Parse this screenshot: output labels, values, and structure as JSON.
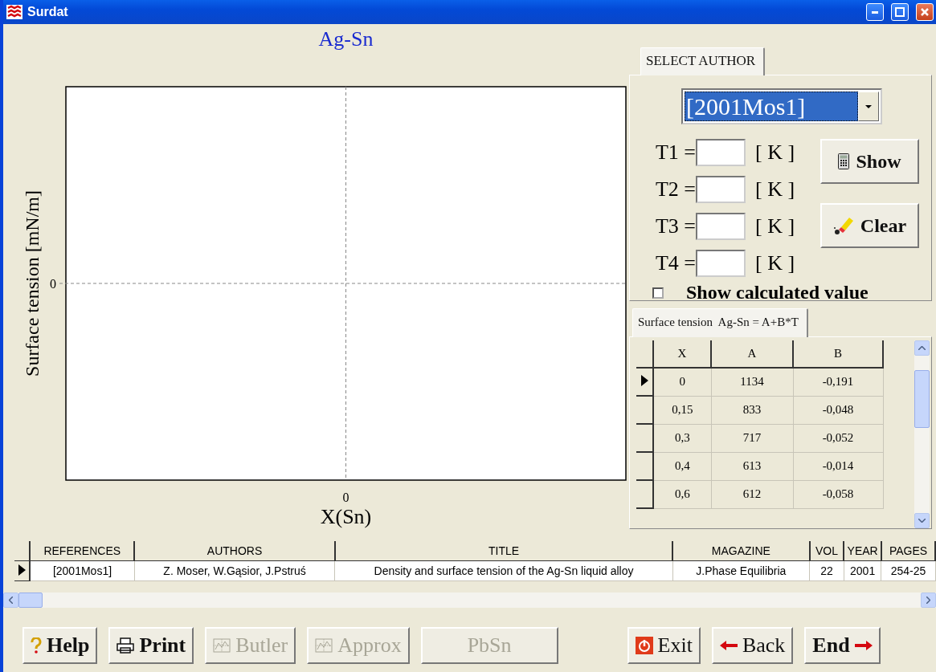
{
  "window": {
    "title": "Surdat"
  },
  "plot": {
    "title": "Ag-Sn",
    "x_axis_label": "X(Sn)",
    "y_axis_label": "Surface tension [mN/m]",
    "x_tick_labels": [
      "0"
    ],
    "y_tick_labels": [
      "0"
    ]
  },
  "author_panel": {
    "tab": {
      "label": "SELECT AUTHOR",
      "selected": true
    },
    "author_select": {
      "value": "[2001Mos1]"
    },
    "temperatures": [
      {
        "label": "T1 =",
        "unit": "[ K ]"
      },
      {
        "label": "T2 =",
        "unit": "[ K ]"
      },
      {
        "label": "T3 =",
        "unit": "[ K ]"
      },
      {
        "label": "T4 =",
        "unit": "[ K ]"
      }
    ],
    "buttons": [
      {
        "label": "Show",
        "kind": "calculator"
      },
      {
        "label": "Clear",
        "kind": "eraser"
      }
    ],
    "show_calculated": {
      "label": "Show calculated value",
      "checked": false
    }
  },
  "coefficients": {
    "tab": {
      "label": "Surface tension  Ag-Sn = A+B*T",
      "selected": true
    },
    "columns": [
      "X",
      "A",
      "B"
    ],
    "rows": [
      {
        "cells": [
          "0",
          "1134",
          "-0,191"
        ],
        "selected": true
      },
      {
        "cells": [
          "0,15",
          "833",
          "-0,048"
        ],
        "selected": false
      },
      {
        "cells": [
          "0,3",
          "717",
          "-0,052"
        ],
        "selected": false
      },
      {
        "cells": [
          "0,4",
          "613",
          "-0,014"
        ],
        "selected": false
      },
      {
        "cells": [
          "0,6",
          "612",
          "-0,058"
        ],
        "selected": false
      }
    ]
  },
  "references": {
    "columns": [
      "REFERENCES",
      "AUTHORS",
      "TITLE",
      "MAGAZINE",
      "VOL",
      "YEAR",
      "PAGES"
    ],
    "rows": [
      {
        "cells": [
          "[2001Mos1]",
          "Z. Moser, W.Gąsior, J.Pstruś",
          "Density and surface tension of the Ag-Sn liquid alloy",
          "J.Phase Equilibria",
          "22",
          "2001",
          "254-25"
        ],
        "selected": true
      }
    ]
  },
  "buttons": [
    {
      "label": "Help",
      "kind": "help",
      "disabled": false
    },
    {
      "label": "Print",
      "kind": "print",
      "disabled": false
    },
    {
      "label": "Butler",
      "kind": "chart",
      "disabled": true
    },
    {
      "label": "Approx",
      "kind": "chart",
      "disabled": true
    },
    {
      "label": "PbSn",
      "kind": "plain",
      "disabled": true
    },
    {
      "label": "Exit",
      "kind": "exit",
      "disabled": false
    },
    {
      "label": "Back",
      "kind": "back",
      "disabled": false
    },
    {
      "label": "End",
      "kind": "end",
      "disabled": false
    }
  ]
}
